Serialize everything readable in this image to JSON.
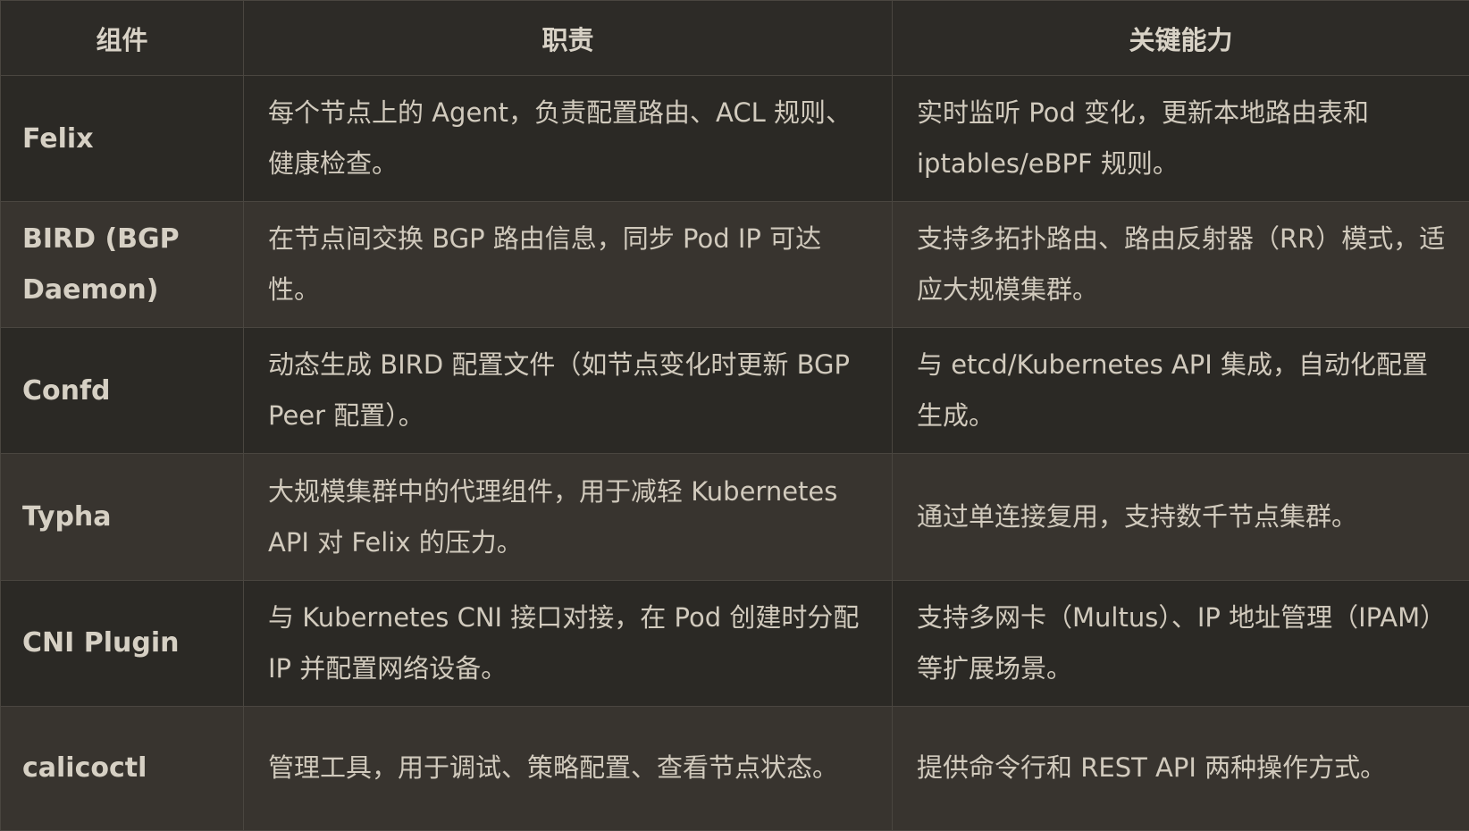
{
  "table": {
    "headers": [
      "组件",
      "职责",
      "关键能力"
    ],
    "rows": [
      {
        "component": "Felix",
        "duty": "每个节点上的 Agent，负责配置路由、ACL 规则、健康检查。",
        "capability": "实时监听 Pod 变化，更新本地路由表和 iptables/eBPF 规则。"
      },
      {
        "component": "BIRD (BGP Daemon)",
        "duty": "在节点间交换 BGP 路由信息，同步 Pod IP 可达性。",
        "capability": "支持多拓扑路由、路由反射器（RR）模式，适应大规模集群。"
      },
      {
        "component": "Confd",
        "duty": "动态生成 BIRD 配置文件（如节点变化时更新 BGP Peer 配置）。",
        "capability": "与 etcd/Kubernetes API 集成，自动化配置生成。"
      },
      {
        "component": "Typha",
        "duty": "大规模集群中的代理组件，用于减轻 Kubernetes API 对 Felix 的压力。",
        "capability": "通过单连接复用，支持数千节点集群。"
      },
      {
        "component": "CNI Plugin",
        "duty": "与 Kubernetes CNI 接口对接，在 Pod 创建时分配 IP 并配置网络设备。",
        "capability": "支持多网卡（Multus）、IP 地址管理（IPAM）等扩展场景。"
      },
      {
        "component": "calicoctl",
        "duty": "管理工具，用于调试、策略配置、查看节点状态。",
        "capability": "提供命令行和 REST API 两种操作方式。"
      }
    ]
  }
}
